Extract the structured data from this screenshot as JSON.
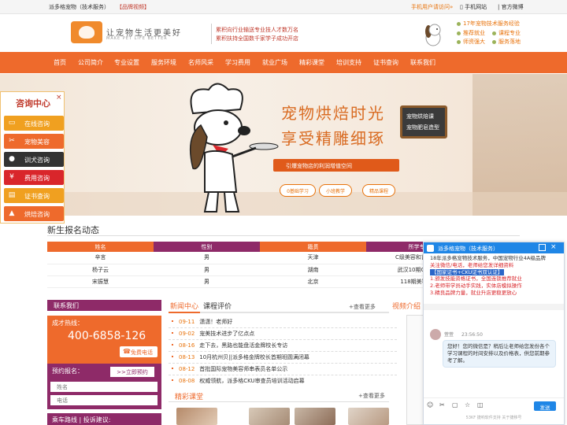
{
  "topbar": {
    "brand": "派多格宠物（技术服务）",
    "video_badge": "【品牌视频】",
    "mobile_user": "手机用户请访问»",
    "mobile_site": "手机网站",
    "weibo": "官方微博"
  },
  "header": {
    "slogan": "让宠物生活更美好",
    "slogan_en": "MAKE PET LIFE BETTER",
    "stat1": "累积向行业输送专业技人才数万名",
    "stat2": "累积扶持全国数千家学子成功开店",
    "features": [
      "17年宠物技术服务经验",
      "推荐就业",
      "课程专业",
      "师资强大",
      "服务落地"
    ]
  },
  "nav": {
    "items": [
      "首页",
      "公司简介",
      "专业设置",
      "服务环境",
      "名师风采",
      "学习费用",
      "就业广场",
      "精彩课堂",
      "培训支持",
      "证书查询",
      "联系我们"
    ]
  },
  "banner": {
    "headline1": "宠物烘焙时光",
    "headline2": "享受精雕细琢",
    "board_line1": "宠物烘焙课",
    "board_line2": "宠物肥皂造型",
    "ribbon": "引爆宠物店的利润增值空间",
    "pills": [
      "0基础学习",
      "小班教学",
      "精品课程"
    ]
  },
  "consult": {
    "title": "咨询中心",
    "close": "×",
    "items": [
      {
        "label": "在线咨询",
        "color": "#f0a020"
      },
      {
        "label": "宠物美容",
        "color": "#ee6a2c"
      },
      {
        "label": "训犬咨询",
        "color": "#333333"
      },
      {
        "label": "费用咨询",
        "color": "#d9262b"
      },
      {
        "label": "证书查询",
        "color": "#f0a020"
      },
      {
        "label": "烘焙咨询",
        "color": "#ee6a2c"
      }
    ]
  },
  "registration": {
    "title": "新生报名动态",
    "headers": [
      "姓名",
      "性别",
      "籍贯",
      "所学专业"
    ],
    "rows": [
      [
        "辛言",
        "男",
        "天津",
        "C级美容和首席违谈"
      ],
      [
        "杨子云",
        "男",
        "湖南",
        "武汉10期C级美容"
      ],
      [
        "宋振慧",
        "男",
        "北京",
        "118期美容全套"
      ]
    ]
  },
  "contact": {
    "tab": "联系我们",
    "hotline_label": "成才热线：",
    "hotline": "400-6858-126",
    "free_call": "免费电话",
    "signup_label": "预约报名：",
    "signup_btn": ">>立即预约",
    "name_placeholder": "姓名",
    "phone_placeholder": "电话",
    "route": "乘车路线 | 投诉建议:"
  },
  "news": {
    "tab_news": "新闻中心",
    "tab_review": "课程评价",
    "more": "+查看更多",
    "items": [
      {
        "date": "09-11",
        "title": "潇潇！老师好"
      },
      {
        "date": "09-02",
        "title": "宠美技术进步了亿点点"
      },
      {
        "date": "08-16",
        "title": "走下去，黑路也能盘活金牌校长专访"
      },
      {
        "date": "08-13",
        "title": "10月杭州贝||派多格金牌校长首期班圆满闭幕"
      },
      {
        "date": "08-12",
        "title": "首批国际宠物美容师串表员名单公示"
      },
      {
        "date": "08-08",
        "title": "权威领航，派多格CKU审查员培训活动启幕"
      }
    ],
    "classroom_title": "精彩课堂",
    "classroom_more": "+查看更多",
    "video_tab": "视频介绍"
  },
  "chat": {
    "title": "派多格宠物（技术服务）",
    "intro": "18年派多格宠物技术服务，中国宠物行业4A级品牌",
    "red_line": "关注微信/电话，老师给您发详细资料",
    "blue_line": "【国家证书+CKU证书双认证】",
    "points": [
      "1.颁发技能资格证书，全国连锁推荐就业",
      "2.老师带学员动手实践，实体店模拟操作",
      "3.精良品牌力量，就业升店更稳更放心"
    ],
    "agent": "萱萱",
    "time": "23:56:50",
    "message": "您好！您的微信是？稍后让老师给您发份各个学习课程的时间安排以及价格表，供您前期参考了解。",
    "send": "发送",
    "footer": "53KF 捷响软件支持 关于捷移号"
  },
  "colors": {
    "orange": "#ee6a2c",
    "purple": "#8e2a68",
    "chat_blue": "#1f86e6"
  }
}
